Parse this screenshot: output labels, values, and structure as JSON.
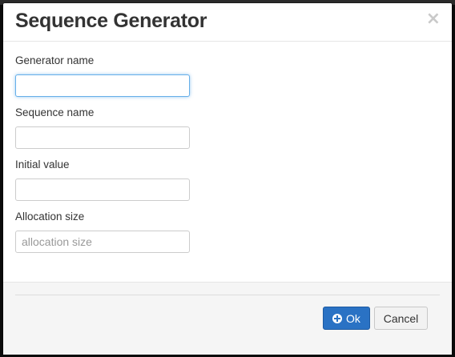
{
  "dialog": {
    "title": "Sequence Generator",
    "close_glyph": "×"
  },
  "fields": {
    "generator_name": {
      "label": "Generator name",
      "value": "",
      "placeholder": ""
    },
    "sequence_name": {
      "label": "Sequence name",
      "value": "",
      "placeholder": ""
    },
    "initial_value": {
      "label": "Initial value",
      "value": "",
      "placeholder": ""
    },
    "allocation_size": {
      "label": "Allocation size",
      "value": "",
      "placeholder": "allocation size"
    }
  },
  "footer": {
    "ok_label": "Ok",
    "ok_icon": "plus-circle-icon",
    "cancel_label": "Cancel"
  },
  "colors": {
    "primary": "#2a72c4",
    "focus": "#66afe9"
  }
}
